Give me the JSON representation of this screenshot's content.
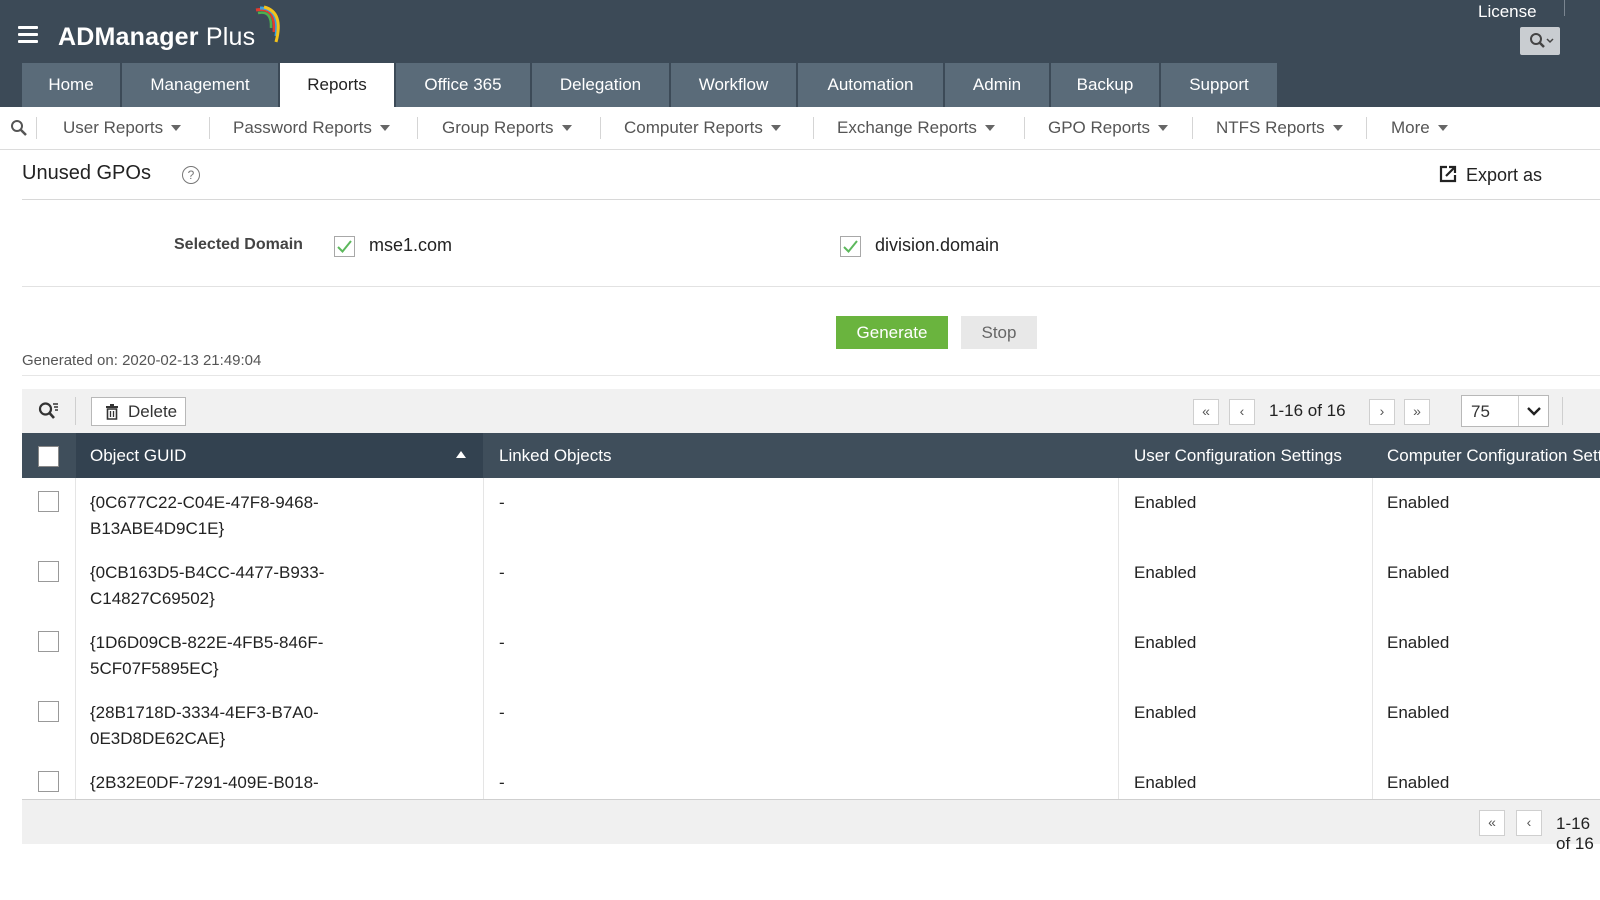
{
  "app": {
    "name_main": "ADManager",
    "name_plus": "Plus",
    "license_link": "License"
  },
  "tabs": [
    {
      "label": "Home",
      "active": false
    },
    {
      "label": "Management",
      "active": false
    },
    {
      "label": "Reports",
      "active": true
    },
    {
      "label": "Office 365",
      "active": false
    },
    {
      "label": "Delegation",
      "active": false
    },
    {
      "label": "Workflow",
      "active": false
    },
    {
      "label": "Automation",
      "active": false
    },
    {
      "label": "Admin",
      "active": false
    },
    {
      "label": "Backup",
      "active": false
    },
    {
      "label": "Support",
      "active": false
    }
  ],
  "subnav": [
    "User Reports",
    "Password Reports",
    "Group Reports",
    "Computer Reports",
    "Exchange Reports",
    "GPO Reports",
    "NTFS Reports",
    "More"
  ],
  "page": {
    "title": "Unused GPOs",
    "help": "?",
    "export_label": "Export as",
    "domain_label": "Selected Domain",
    "domains": [
      {
        "name": "mse1.com",
        "checked": true
      },
      {
        "name": "division.domain",
        "checked": true
      }
    ],
    "generate_label": "Generate",
    "stop_label": "Stop",
    "generated_on": "Generated on: 2020-02-13 21:49:04"
  },
  "grid": {
    "delete_label": "Delete",
    "page_range": "1-16 of 16",
    "page_size": "75",
    "columns": [
      "Object GUID",
      "Linked Objects",
      "User Configuration Settings",
      "Computer Configuration Settings"
    ],
    "sort_column": "Object GUID",
    "sort_direction": "ascending",
    "rows": [
      {
        "guid_line1": "{0C677C22-C04E-47F8-9468-",
        "guid_line2": "B13ABE4D9C1E}",
        "linked": "-",
        "user_cfg": "Enabled",
        "comp_cfg": "Enabled"
      },
      {
        "guid_line1": "{0CB163D5-B4CC-4477-B933-",
        "guid_line2": "C14827C69502}",
        "linked": "-",
        "user_cfg": "Enabled",
        "comp_cfg": "Enabled"
      },
      {
        "guid_line1": "{1D6D09CB-822E-4FB5-846F-",
        "guid_line2": "5CF07F5895EC}",
        "linked": "-",
        "user_cfg": "Enabled",
        "comp_cfg": "Enabled"
      },
      {
        "guid_line1": "{28B1718D-3334-4EF3-B7A0-",
        "guid_line2": "0E3D8DE62CAE}",
        "linked": "-",
        "user_cfg": "Enabled",
        "comp_cfg": "Enabled"
      },
      {
        "guid_line1": "{2B32E0DF-7291-409E-B018-",
        "guid_line2": "",
        "linked": "-",
        "user_cfg": "Enabled",
        "comp_cfg": "Enabled"
      }
    ],
    "footer_page_range": "1-16 of 16"
  },
  "colors": {
    "header_bg": "#3c4a57",
    "tab_bg": "#5a6b79",
    "table_header_bg": "#3f4e5b",
    "generate_green": "#6ab43e",
    "check_green": "#5cb85c"
  },
  "icons": [
    "menu-icon",
    "search-icon",
    "help-icon",
    "export-icon",
    "checkmark-icon",
    "trash-icon",
    "first-page-icon",
    "prev-page-icon",
    "next-page-icon",
    "last-page-icon",
    "chevron-down-icon",
    "sort-ascending-icon"
  ]
}
